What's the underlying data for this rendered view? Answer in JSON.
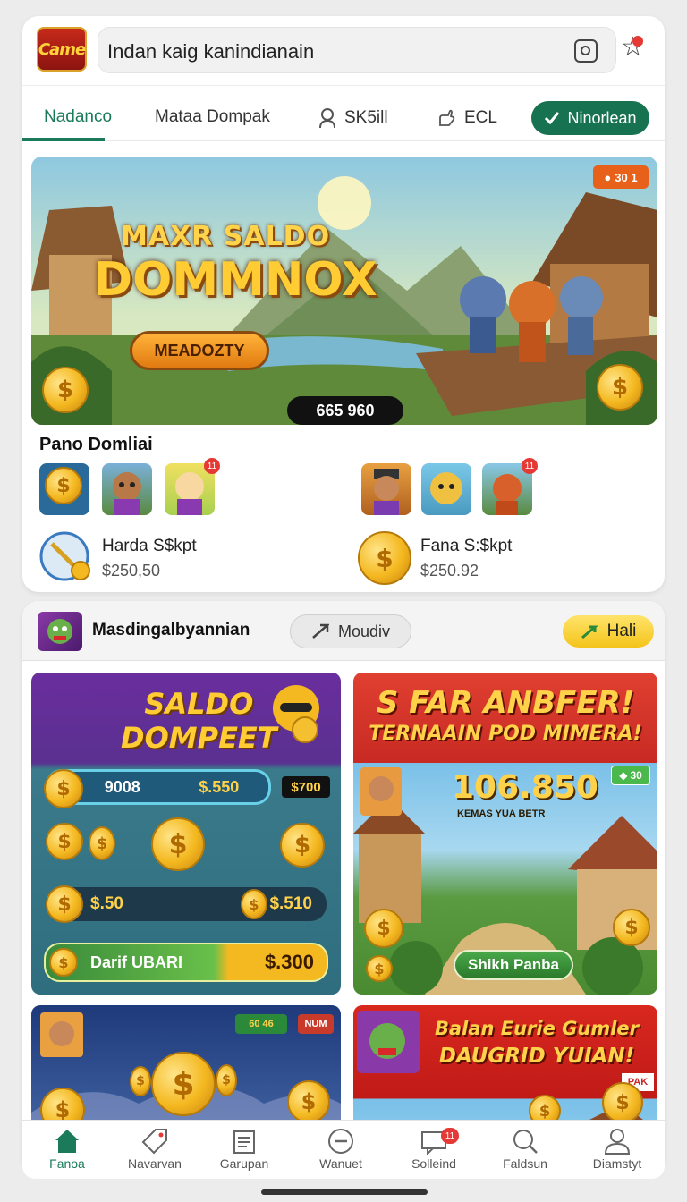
{
  "header": {
    "logo_text": "Came",
    "search_text": "Indan kaig kanindianain",
    "camera_icon": "camera-icon",
    "favorite_icon": "star-notification-icon"
  },
  "tabs": [
    {
      "label": "Nadanco",
      "active": true
    },
    {
      "label": "Mataa Dompak"
    },
    {
      "label": "SK5ill",
      "icon": "user-icon"
    },
    {
      "label": "ECL",
      "icon": "hand-icon"
    }
  ],
  "tab_button": {
    "label": "Ninorlean",
    "icon": "check-icon"
  },
  "hero": {
    "title_line1": "MAXR SALDO",
    "title_line2": "DOMMNOX",
    "button_label": "MEADOZTY",
    "counter": "665 960",
    "badge": "30 1"
  },
  "featured": {
    "title": "Pano Domliai",
    "thumb_badge": "11",
    "items": [
      {
        "name": "Harda S$kpt",
        "price": "$250,50"
      },
      {
        "name": "Fana S:$kpt",
        "price": "$250.92"
      }
    ]
  },
  "category": {
    "title": "Masdingalbyannian",
    "button_label": "Moudiv",
    "button2_label": "Hali"
  },
  "promo1": {
    "title_line1": "SALDO",
    "title_line2": "DOMPEET",
    "bar1_left": "9008",
    "bar1_right": "$.550",
    "bar1_tag": "$700",
    "bar2_left": "$.50",
    "bar2_right": "$.510",
    "bar3_label": "Darif UBARI",
    "bar3_value": "$.300"
  },
  "promo2": {
    "title": "S FAR ANBFER!",
    "subtitle": "TERNAAIN POD MIMERA!",
    "amount": "106.850",
    "caption": "KEMAS YUA BETR",
    "badge": "30",
    "button_label": "Shikh Panba"
  },
  "promo3": {
    "badge": "60 46",
    "tag": "NUM"
  },
  "promo4": {
    "title_line1": "Balan Eurie Gumler",
    "title_line2": "DAUGRID YUIAN!",
    "tag": "PAK"
  },
  "nav": [
    {
      "label": "Fanoa",
      "icon": "home-icon",
      "active": true
    },
    {
      "label": "Navarvan",
      "icon": "tag-icon"
    },
    {
      "label": "Garupan",
      "icon": "document-icon"
    },
    {
      "label": "Wanuet",
      "icon": "minus-circle-icon"
    },
    {
      "label": "Solleind",
      "icon": "message-icon",
      "badge": "11"
    },
    {
      "label": "Faldsun",
      "icon": "search-icon"
    },
    {
      "label": "Diamstyt",
      "icon": "profile-icon"
    }
  ],
  "colors": {
    "accent": "#1a7a5a",
    "gold": "#f4b820",
    "badge_red": "#e53935"
  }
}
